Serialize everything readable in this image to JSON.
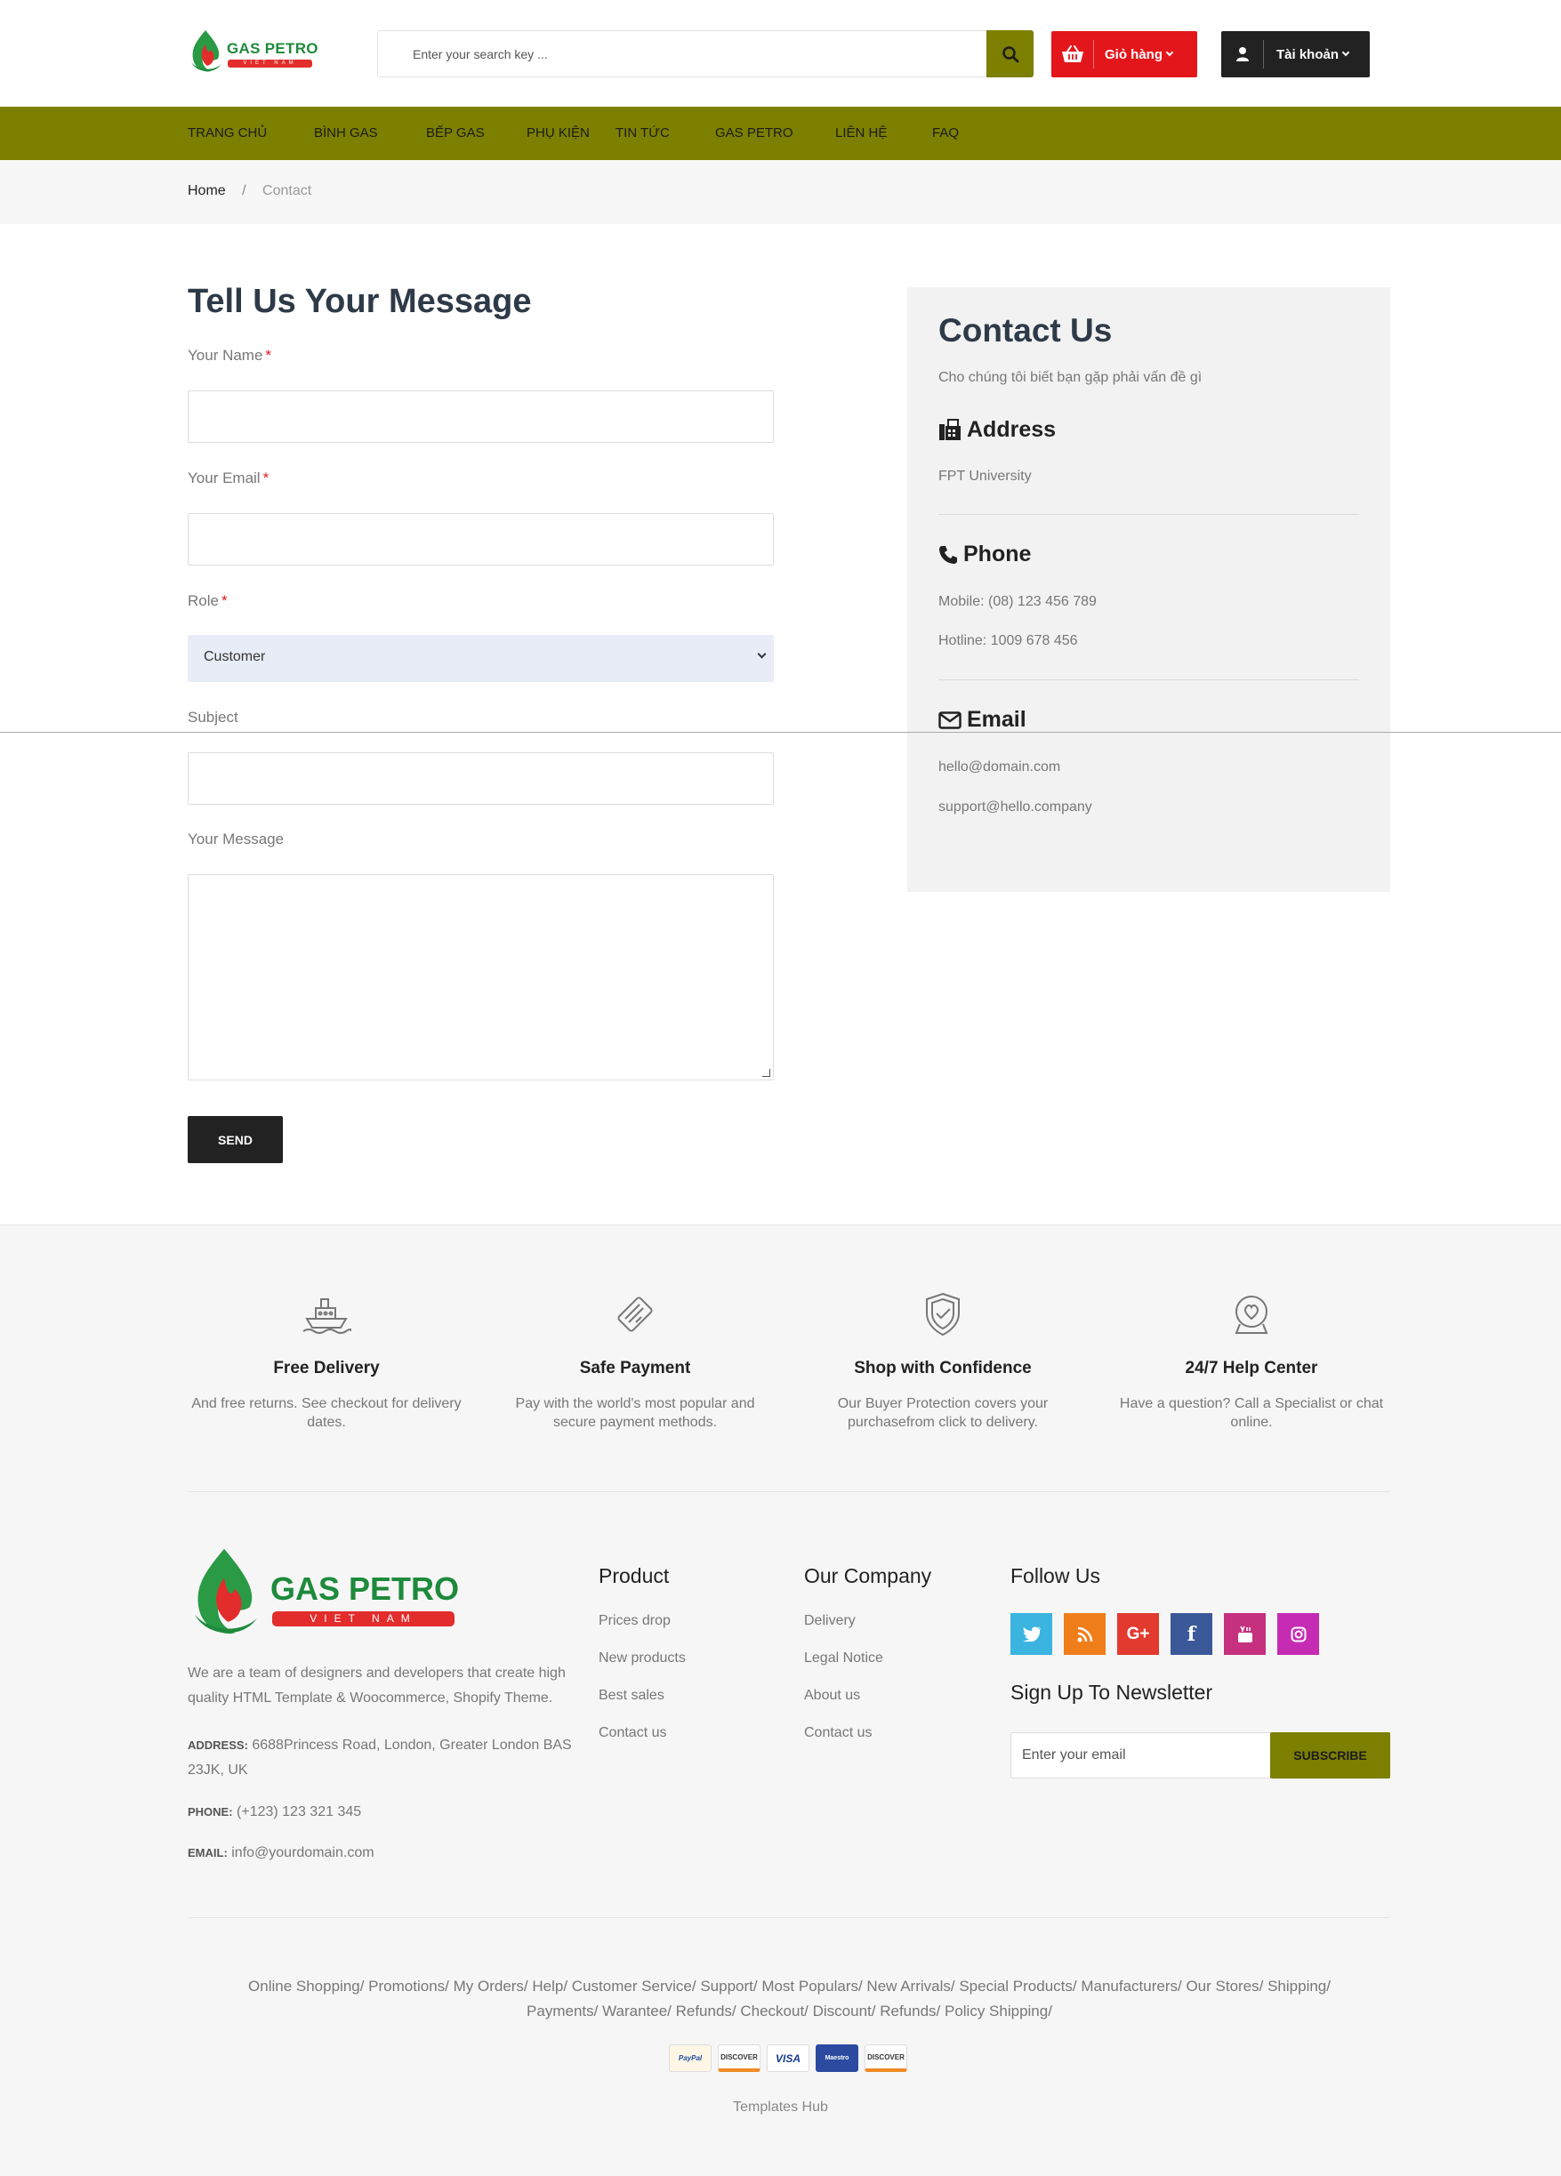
{
  "header": {
    "logo_text": "GAS PETRO",
    "logo_sub": "VIET NAM",
    "search_placeholder": "Enter your search key ...",
    "cart_label": "Giỏ hàng",
    "account_label": "Tài khoản"
  },
  "nav": {
    "items": [
      {
        "label": "TRANG CHỦ"
      },
      {
        "label": "BÌNH GAS"
      },
      {
        "label": "BẾP GAS"
      },
      {
        "label": "PHỤ KIỆN"
      },
      {
        "label": "TIN TỨC"
      },
      {
        "label": "GAS PETRO"
      },
      {
        "label": "LIÊN HỆ"
      },
      {
        "label": "FAQ"
      }
    ]
  },
  "breadcrumb": {
    "home": "Home",
    "separator": "/",
    "current": "Contact"
  },
  "form": {
    "title": "Tell Us Your Message",
    "name_label": "Your Name",
    "email_label": "Your Email",
    "role_label": "Role",
    "role_value": "Customer",
    "subject_label": "Subject",
    "message_label": "Your Message",
    "required_mark": "*",
    "send_label": "SEND"
  },
  "contact": {
    "title": "Contact Us",
    "intro": "Cho chúng tôi biết bạn gặp phải vấn đề gì",
    "address_title": "Address",
    "address": "FPT University",
    "phone_title": "Phone",
    "mobile": "Mobile: (08) 123 456 789",
    "hotline": "Hotline: 1009 678 456",
    "email_title": "Email",
    "email1": "hello@domain.com",
    "email2": "support@hello.company"
  },
  "features": [
    {
      "title": "Free Delivery",
      "desc": "And free returns. See checkout for delivery dates.",
      "icon": "ship-icon"
    },
    {
      "title": "Safe Payment",
      "desc": "Pay with the world's most popular and secure payment methods.",
      "icon": "card-icon"
    },
    {
      "title": "Shop with Confidence",
      "desc": "Our Buyer Protection covers your purchasefrom click to delivery.",
      "icon": "shield-icon"
    },
    {
      "title": "24/7 Help Center",
      "desc": "Have a question? Call a Specialist or chat online.",
      "icon": "support-icon"
    }
  ],
  "footer": {
    "logo_text": "GAS PETRO",
    "logo_sub": "VIET NAM",
    "about": "We are a team of designers and developers that create high quality HTML Template & Woocommerce, Shopify Theme.",
    "address_label": "ADDRESS:",
    "address": "6688Princess Road, London, Greater London BAS 23JK, UK",
    "phone_label": "PHONE:",
    "phone": "(+123) 123 321 345",
    "email_label": "EMAIL:",
    "email": "info@yourdomain.com",
    "product_title": "Product",
    "product_links": [
      "Prices drop",
      "New products",
      "Best sales",
      "Contact us"
    ],
    "company_title": "Our Company",
    "company_links": [
      "Delivery",
      "Legal Notice",
      "About us",
      "Contact us"
    ],
    "follow_title": "Follow Us",
    "social": [
      {
        "name": "twitter-icon",
        "color": "#3bb4df"
      },
      {
        "name": "rss-icon",
        "color": "#ef7d1a"
      },
      {
        "name": "google-plus-icon",
        "color": "#e23a2f"
      },
      {
        "name": "facebook-icon",
        "color": "#3b5998"
      },
      {
        "name": "youtube-icon",
        "color": "#c5307f"
      },
      {
        "name": "instagram-icon",
        "color": "#c62bb3"
      }
    ],
    "newsletter_title": "Sign Up To Newsletter",
    "newsletter_placeholder": "Enter your email",
    "subscribe_label": "SUBSCRIBE",
    "bottom_links_line1": "Online Shopping/ Promotions/ My Orders/ Help/ Customer Service/ Support/ Most Populars/ New Arrivals/ Special Products/ Manufacturers/ Our Stores/ Shipping/",
    "bottom_links_line2": "Payments/ Warantee/ Refunds/ Checkout/ Discount/ Refunds/ Policy Shipping/",
    "payments": [
      "PayPal",
      "DISCOVER",
      "VISA",
      "Maestro",
      "DISCOVER"
    ],
    "copyright": "Templates Hub"
  },
  "colors": {
    "brand_olive": "#7c7f00",
    "cart_red": "#e3171b",
    "dark": "#222222",
    "logo_green": "#1e8a3c"
  }
}
